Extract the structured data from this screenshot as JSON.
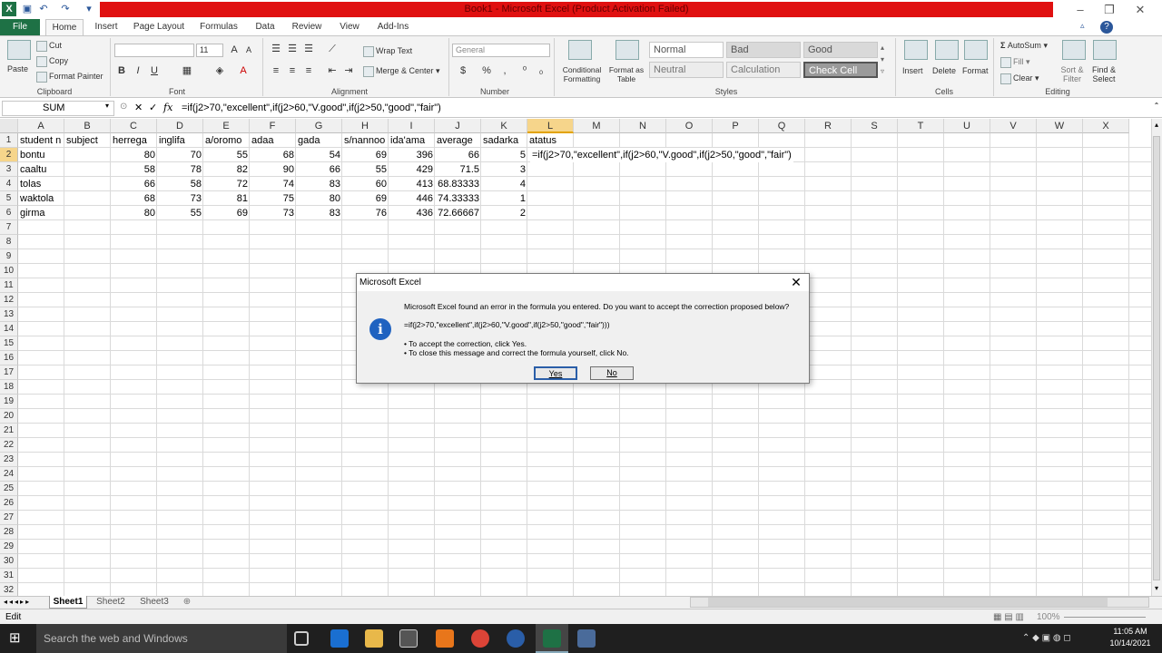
{
  "window": {
    "title": "Book1 - Microsoft Excel (Product Activation Failed)",
    "help_icon": "?",
    "minimize": "–",
    "restore": "❐",
    "close": "✕"
  },
  "tabs": {
    "file": "File",
    "items": [
      "Home",
      "Insert",
      "Page Layout",
      "Formulas",
      "Data",
      "Review",
      "View",
      "Add-Ins"
    ]
  },
  "ribbon": {
    "clipboard": {
      "label": "Clipboard",
      "paste": "Paste",
      "cut": "Cut",
      "copy": "Copy",
      "format_painter": "Format Painter"
    },
    "font": {
      "label": "Font",
      "size": "11",
      "bold": "B",
      "italic": "I",
      "underline": "U"
    },
    "alignment": {
      "label": "Alignment",
      "wrap_text": "Wrap Text",
      "merge_center": "Merge & Center"
    },
    "number": {
      "label": "Number",
      "format": "General",
      "currency": "$",
      "percent": "%",
      "comma": ","
    },
    "styles": {
      "label": "Styles",
      "conditional": "Conditional Formatting",
      "format_table": "Format as Table",
      "normal": "Normal",
      "bad": "Bad",
      "good": "Good",
      "neutral": "Neutral",
      "calculation": "Calculation",
      "check_cell": "Check Cell"
    },
    "cells": {
      "label": "Cells",
      "insert": "Insert",
      "delete": "Delete",
      "format": "Format"
    },
    "editing": {
      "label": "Editing",
      "autosum": "AutoSum",
      "fill": "Fill",
      "clear": "Clear",
      "sort_filter": "Sort & Filter",
      "find_select": "Find & Select"
    }
  },
  "formula_bar": {
    "name_box": "SUM",
    "fx": "fx",
    "formula": "=if(j2>70,\"excellent\",if(j2>60,\"V.good\",if(j2>50,\"good\",\"fair\")"
  },
  "columns": [
    "A",
    "B",
    "C",
    "D",
    "E",
    "F",
    "G",
    "H",
    "I",
    "J",
    "K",
    "L",
    "M",
    "N",
    "O",
    "P",
    "Q",
    "R",
    "S",
    "T",
    "U",
    "V",
    "W",
    "X"
  ],
  "rows": [
    "1",
    "2",
    "3",
    "4",
    "5",
    "6",
    "7",
    "8",
    "9",
    "10",
    "11",
    "12",
    "13",
    "14",
    "15",
    "16",
    "17",
    "18",
    "19",
    "20",
    "21",
    "22",
    "23",
    "24",
    "25",
    "26",
    "27",
    "28",
    "29",
    "30",
    "31",
    "32"
  ],
  "sheet": {
    "headers": [
      "student n",
      "subject",
      "herrega",
      "inglifa",
      "a/oromo",
      "adaa",
      "gada",
      "s/nannoo",
      "ida'ama",
      "average",
      "sadarka",
      "atatus"
    ],
    "data": [
      [
        "bontu",
        "",
        "80",
        "70",
        "55",
        "68",
        "54",
        "69",
        "396",
        "66",
        "5"
      ],
      [
        "caaltu",
        "",
        "58",
        "78",
        "82",
        "90",
        "66",
        "55",
        "429",
        "71.5",
        "3"
      ],
      [
        "tolas",
        "",
        "66",
        "58",
        "72",
        "74",
        "83",
        "60",
        "413",
        "68.83333",
        "4"
      ],
      [
        "waktola",
        "",
        "68",
        "73",
        "81",
        "75",
        "80",
        "69",
        "446",
        "74.33333",
        "1"
      ],
      [
        "girma",
        "",
        "80",
        "55",
        "69",
        "73",
        "83",
        "76",
        "436",
        "72.66667",
        "2"
      ]
    ],
    "editing_cell": "=if(j2>70,\"excellent\",if(j2>60,\"V.good\",if(j2>50,\"good\",\"fair\")"
  },
  "sheet_tabs": [
    "Sheet1",
    "Sheet2",
    "Sheet3"
  ],
  "status": {
    "mode": "Edit",
    "zoom": "100%"
  },
  "dialog": {
    "title": "Microsoft Excel",
    "message": "Microsoft Excel found an error in the formula you entered. Do you want to accept the correction proposed below?",
    "proposed": "=if(j2>70,\"excellent\",if(j2>60,\"V.good\",if(j2>50,\"good\",\"fair\")))",
    "bullet1": "• To accept the correction, click Yes.",
    "bullet2": "• To close this message and correct the formula yourself, click No.",
    "yes": "Yes",
    "no": "No",
    "icon_letter": "i"
  },
  "taskbar": {
    "search": "Search the web and Windows",
    "time": "11:05 AM",
    "date": "10/14/2021"
  },
  "colors": {
    "excel_green": "#1e7145",
    "title_red": "#e01010",
    "taskbar": "#1f1f1f",
    "dialog_icon": "#1f62c0"
  }
}
